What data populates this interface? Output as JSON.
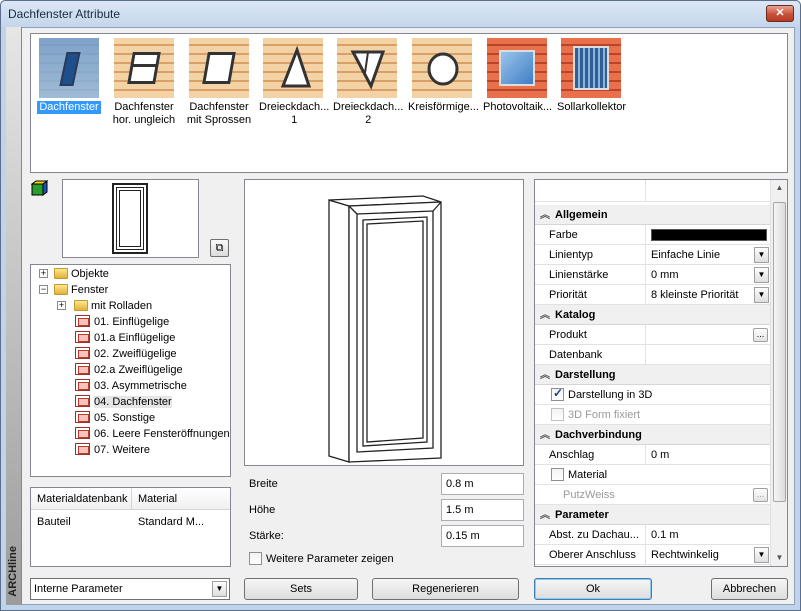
{
  "window": {
    "title": "Dachfenster Attribute",
    "close_label": "✕"
  },
  "brand": "ARCHline",
  "gallery": [
    {
      "label": "Dachfenster",
      "selected": true,
      "icon": "roof-window-icon"
    },
    {
      "label": "Dachfenster hor. ungleich",
      "selected": false,
      "icon": "roof-window-horizontal-uneven-icon"
    },
    {
      "label": "Dachfenster mit Sprossen",
      "selected": false,
      "icon": "roof-window-mullions-icon"
    },
    {
      "label": "Dreieckdach... 1",
      "selected": false,
      "icon": "triangle-roof-window-1-icon"
    },
    {
      "label": "Dreieckdach... 2",
      "selected": false,
      "icon": "triangle-roof-window-2-icon"
    },
    {
      "label": "Kreisförmige...",
      "selected": false,
      "icon": "circular-roof-window-icon"
    },
    {
      "label": "Photovoltaik...",
      "selected": false,
      "icon": "photovoltaic-panel-icon"
    },
    {
      "label": "Sollarkollektor",
      "selected": false,
      "icon": "solar-collector-icon"
    }
  ],
  "tree": {
    "items": [
      {
        "label": "Objekte",
        "level": 0,
        "type": "folder",
        "expander": "+"
      },
      {
        "label": "Fenster",
        "level": 0,
        "type": "folder",
        "expander": "−"
      },
      {
        "label": "mit Rolladen",
        "level": 1,
        "type": "folder",
        "expander": "+"
      },
      {
        "label": "01. Einflügelige",
        "level": 1,
        "type": "window"
      },
      {
        "label": "01.a Einflügelige",
        "level": 1,
        "type": "window"
      },
      {
        "label": "02. Zweiflügelige",
        "level": 1,
        "type": "window"
      },
      {
        "label": "02.a Zweiflügelige",
        "level": 1,
        "type": "window"
      },
      {
        "label": "03. Asymmetrische",
        "level": 1,
        "type": "window"
      },
      {
        "label": "04. Dachfenster",
        "level": 1,
        "type": "window",
        "selected": true
      },
      {
        "label": "05. Sonstige",
        "level": 1,
        "type": "window"
      },
      {
        "label": "06. Leere Fensteröffnungen",
        "level": 1,
        "type": "window"
      },
      {
        "label": "07. Weitere",
        "level": 1,
        "type": "window"
      }
    ]
  },
  "material_grid": {
    "headers": [
      "Materialdatenbank",
      "Material"
    ],
    "rows": [
      [
        "Bauteil",
        "Standard M..."
      ]
    ]
  },
  "params": {
    "breite_label": "Breite",
    "breite_value": "0.8 m",
    "hoehe_label": "Höhe",
    "hoehe_value": "1.5 m",
    "staerke_label": "Stärke:",
    "staerke_value": "0.15 m",
    "more_label": "Weitere Parameter zeigen"
  },
  "properties": {
    "allgemein": "Allgemein",
    "farbe": "Farbe",
    "farbe_color": "#000000",
    "linientyp": "Linientyp",
    "linientyp_value": "Einfache Linie",
    "linienstaerke": "Linienstärke",
    "linienstaerke_value": "0 mm",
    "prioritaet": "Priorität",
    "prioritaet_value": "8 kleinste Priorität",
    "katalog": "Katalog",
    "produkt": "Produkt",
    "datenbank": "Datenbank",
    "darstellung": "Darstellung",
    "darstellung_3d": "Darstellung in 3D",
    "form_fixiert": "3D Form fixiert",
    "dachverbindung": "Dachverbindung",
    "anschlag": "Anschlag",
    "anschlag_value": "0 m",
    "material": "Material",
    "putzweiss": "PutzWeiss",
    "parameter": "Parameter",
    "abst": "Abst. zu Dachau...",
    "abst_value": "0.1 m",
    "oberer": "Oberer Anschluss",
    "oberer_value": "Rechtwinkelig"
  },
  "footer": {
    "combo_value": "Interne Parameter",
    "sets": "Sets",
    "regenerieren": "Regenerieren",
    "ok": "Ok",
    "abbrechen": "Abbrechen"
  }
}
